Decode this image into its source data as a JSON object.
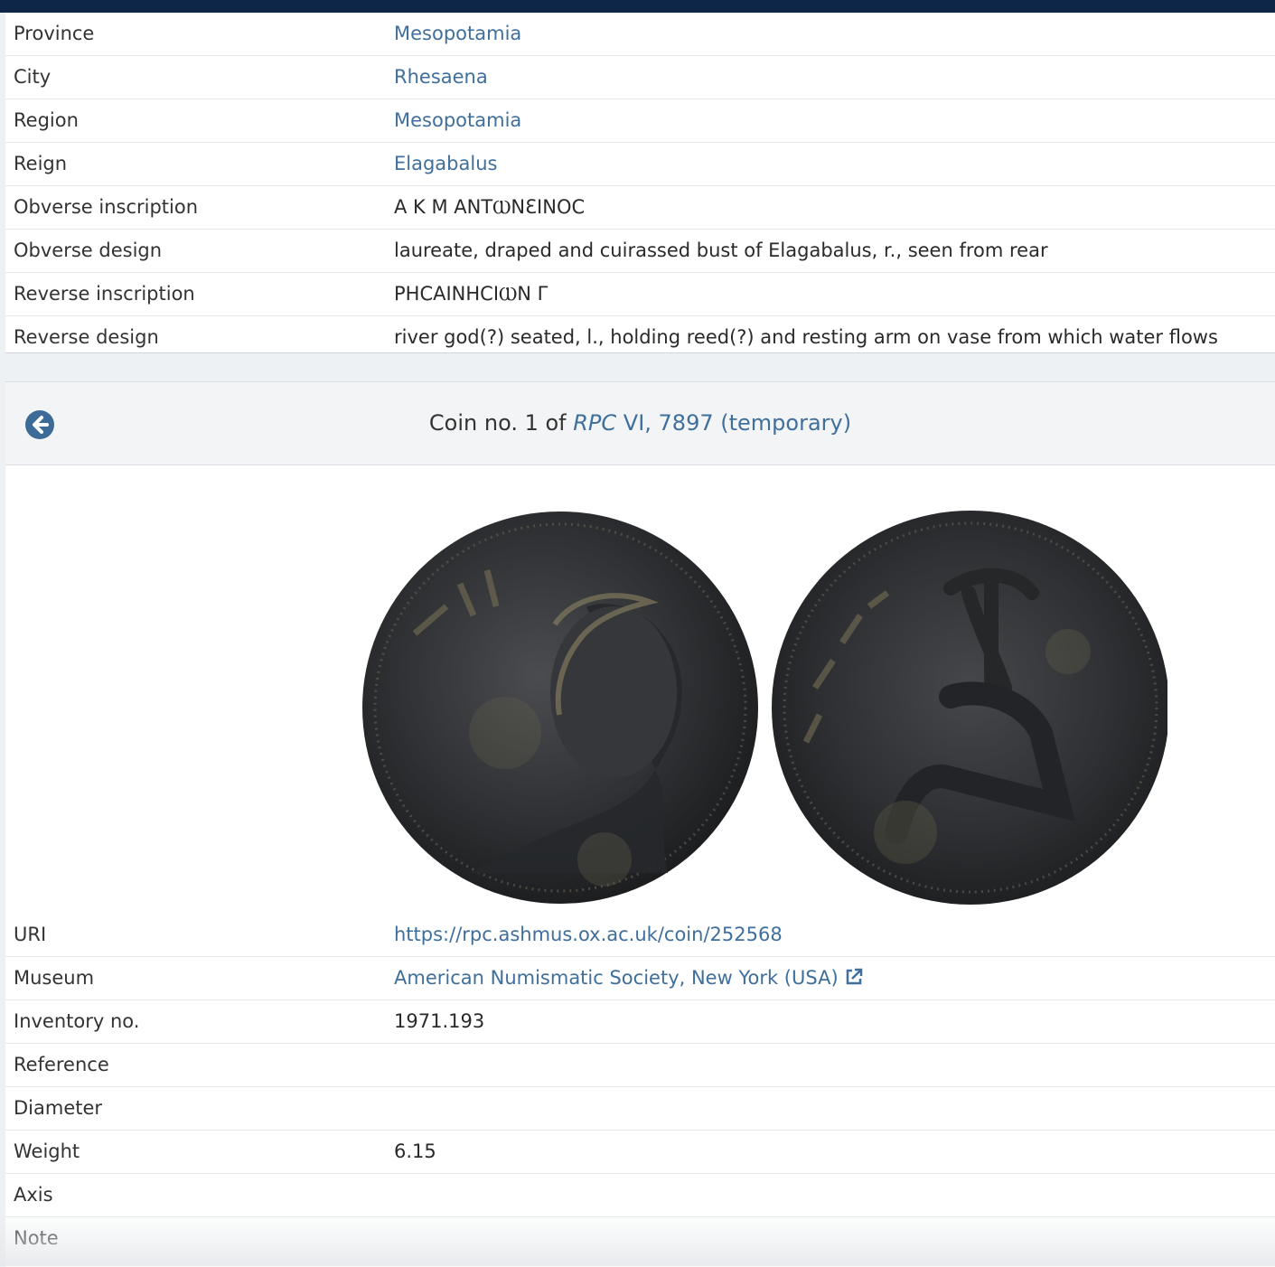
{
  "details": [
    {
      "label": "Province",
      "value": "Mesopotamia",
      "link": true
    },
    {
      "label": "City",
      "value": "Rhesaena",
      "link": true
    },
    {
      "label": "Region",
      "value": "Mesopotamia",
      "link": true
    },
    {
      "label": "Reign",
      "value": "Elagabalus",
      "link": true
    },
    {
      "label": "Obverse inscription",
      "value": "Α Κ Μ ΑΝΤⲰΝƐΙΝΟϹ",
      "link": false
    },
    {
      "label": "Obverse design",
      "value": "laureate, draped and cuirassed bust of Elagabalus, r., seen from rear",
      "link": false
    },
    {
      "label": "Reverse inscription",
      "value": "ΡΗϹΑΙΝΗϹΙⲰΝ Γ",
      "link": false
    },
    {
      "label": "Reverse design",
      "value": "river god(?) seated, l., holding reed(?) and resting arm on vase from which water flows",
      "link": false
    }
  ],
  "coin_panel": {
    "title_prefix": "Coin no. 1 of ",
    "title_rpc": "RPC",
    "title_ref": " VI, 7897 (temporary)",
    "back_icon": "arrow-circle-left-icon",
    "obverse_image": "coin obverse photo",
    "reverse_image": "coin reverse photo"
  },
  "coin_details": [
    {
      "label": "URI",
      "value": "https://rpc.ashmus.ox.ac.uk/coin/252568",
      "link": true
    },
    {
      "label": "Museum",
      "value": "American Numismatic Society, New York (USA)",
      "link": true,
      "icon": "external-link-icon"
    },
    {
      "label": "Inventory no.",
      "value": "1971.193",
      "link": false
    },
    {
      "label": "Reference",
      "value": "",
      "link": false
    },
    {
      "label": "Diameter",
      "value": "",
      "link": false
    },
    {
      "label": "Weight",
      "value": "6.15",
      "link": false
    },
    {
      "label": "Axis",
      "value": "",
      "link": false
    },
    {
      "label": "Note",
      "value": "",
      "link": false
    }
  ],
  "colors": {
    "topbar": "#0e2748",
    "link": "#3f6f9c",
    "back_button": "#3d6b98"
  }
}
